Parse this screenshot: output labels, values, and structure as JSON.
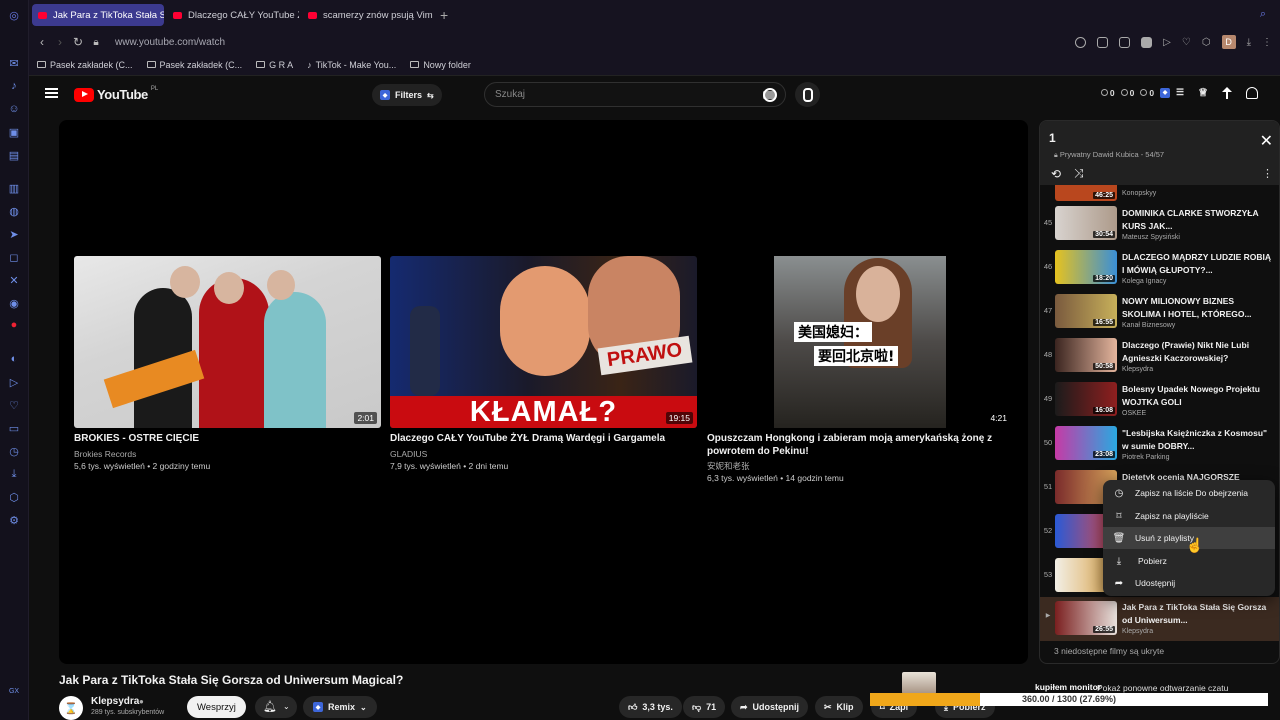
{
  "browser": {
    "tabs": [
      {
        "label": "Jak Para z TikToka Stała S"
      },
      {
        "label": "Dlaczego CAŁY YouTube Ż"
      },
      {
        "label": "scamerzy znów psują Vim"
      }
    ],
    "new_tab": "+",
    "url": "www.youtube.com/watch",
    "profile_initial": "D",
    "bookmarks": [
      {
        "label": "Pasek zakładek (C..."
      },
      {
        "label": "Pasek zakładek (C..."
      },
      {
        "label": "G R A"
      },
      {
        "label": "TikTok - Make You..."
      },
      {
        "label": "Nowy folder"
      }
    ]
  },
  "youtube": {
    "logo_text": "YouTube",
    "logo_country": "PL",
    "filters_label": "Filters",
    "search_placeholder": "Szukaj",
    "counters": [
      "0",
      "0",
      "0"
    ]
  },
  "endcards": [
    {
      "title": "BROKIES - OSTRE CIĘCIE",
      "channel": "Brokies Records",
      "meta": "5,6 tys. wyświetleń • 2 godziny temu",
      "duration": "2:01"
    },
    {
      "title": "Dlaczego CAŁY YouTube ŻYŁ Dramą Wardęgi i Gargamela",
      "channel": "GLADIUS",
      "meta": "7,9 tys. wyświetleń • 2 dni temu",
      "duration": "19:15",
      "overlay_word": "KŁAMAŁ?",
      "overlay_sign": "PRAWO"
    },
    {
      "title": "Opuszczam Hongkong i zabieram moją amerykańską żonę z powrotem do Pekinu!",
      "channel": "安妮和老张",
      "meta": "6,3 tys. wyświetleń • 14 godzin temu",
      "duration": "4:21",
      "caption_1": "美国媳妇：",
      "caption_2": "要回北京啦!"
    }
  ],
  "video": {
    "title": "Jak Para z TikToka Stała Się Gorsza od Uniwersum Magical?",
    "channel": "Klepsydra",
    "subscribers": "289 tys. subskrybentów",
    "support_label": "Wesprzyj",
    "remix_label": "Remix",
    "likes": "3,3 tys.",
    "dislikes": "71",
    "share_label": "Udostępnij",
    "clip_label": "Klip",
    "save_label": "Zapi",
    "download_label": "Pobierz"
  },
  "download_overlay": {
    "label_1": "kupiłem monitor",
    "label_2": "Pokaż ponowne odtwarzanie czatu",
    "progress_text": "360.00 / 1300 (27.69%)",
    "progress": 0.2769
  },
  "playlist": {
    "title": "1",
    "privacy": "Prywatny",
    "owner_count": "Dawid Kubica - 54/57",
    "partial_channel": "Konopskyy",
    "partial_duration": "46:25",
    "items": [
      {
        "index": "45",
        "title": "DOMINIKA CLARKE STWORZYŁA KURS JAK...",
        "channel": "Mateusz Spysiński",
        "duration": "30:54"
      },
      {
        "index": "46",
        "title": "DLACZEGO MĄDRZY LUDZIE ROBIĄ I MÓWIĄ GŁUPOTY?...",
        "channel": "Kolega Ignacy",
        "duration": "18:20"
      },
      {
        "index": "47",
        "title": "NOWY MILIONOWY BIZNES SKOLIMA I HOTEL, KTÓREGO...",
        "channel": "Kanał Biznesowy",
        "duration": "16:55"
      },
      {
        "index": "48",
        "title": "Dlaczego (Prawie) Nikt Nie Lubi Agnieszki Kaczorowskiej?",
        "channel": "Klepsydra",
        "duration": "50:58"
      },
      {
        "index": "49",
        "title": "Bolesny Upadek Nowego Projektu WOJTKA GOLI",
        "channel": "OSKEE",
        "duration": "16:08"
      },
      {
        "index": "50",
        "title": "\"Lesbijska Księżniczka z Kosmosu\" w sumie DOBRY...",
        "channel": "Piotrek Parking",
        "duration": "23:08"
      },
      {
        "index": "51",
        "title": "Dietetyk ocenia NAJGORSZE",
        "channel": "",
        "duration": ""
      },
      {
        "index": "52",
        "title": "",
        "channel": "",
        "duration": "17"
      },
      {
        "index": "53",
        "title": "",
        "channel": "",
        "duration": "11"
      },
      {
        "index": "▶",
        "title": "Jak Para z TikToka Stała Się Gorsza od Uniwersum...",
        "channel": "Klepsydra",
        "duration": "26:55"
      }
    ],
    "footer": "3 niedostępne filmy są ukryte"
  },
  "context_menu": {
    "items": [
      {
        "label": "Zapisz na liście Do obejrzenia",
        "icon": "clock-icon"
      },
      {
        "label": "Zapisz na playliście",
        "icon": "bookmark-icon"
      },
      {
        "label": "Usuń z playlisty",
        "icon": "trash-icon"
      },
      {
        "label": "Pobierz",
        "icon": "download-icon"
      },
      {
        "label": "Udostępnij",
        "icon": "share-icon"
      }
    ]
  },
  "colors": {
    "accent": "#3c3a8f",
    "youtube_red": "#ff0000",
    "progress": "#f0a71a"
  }
}
